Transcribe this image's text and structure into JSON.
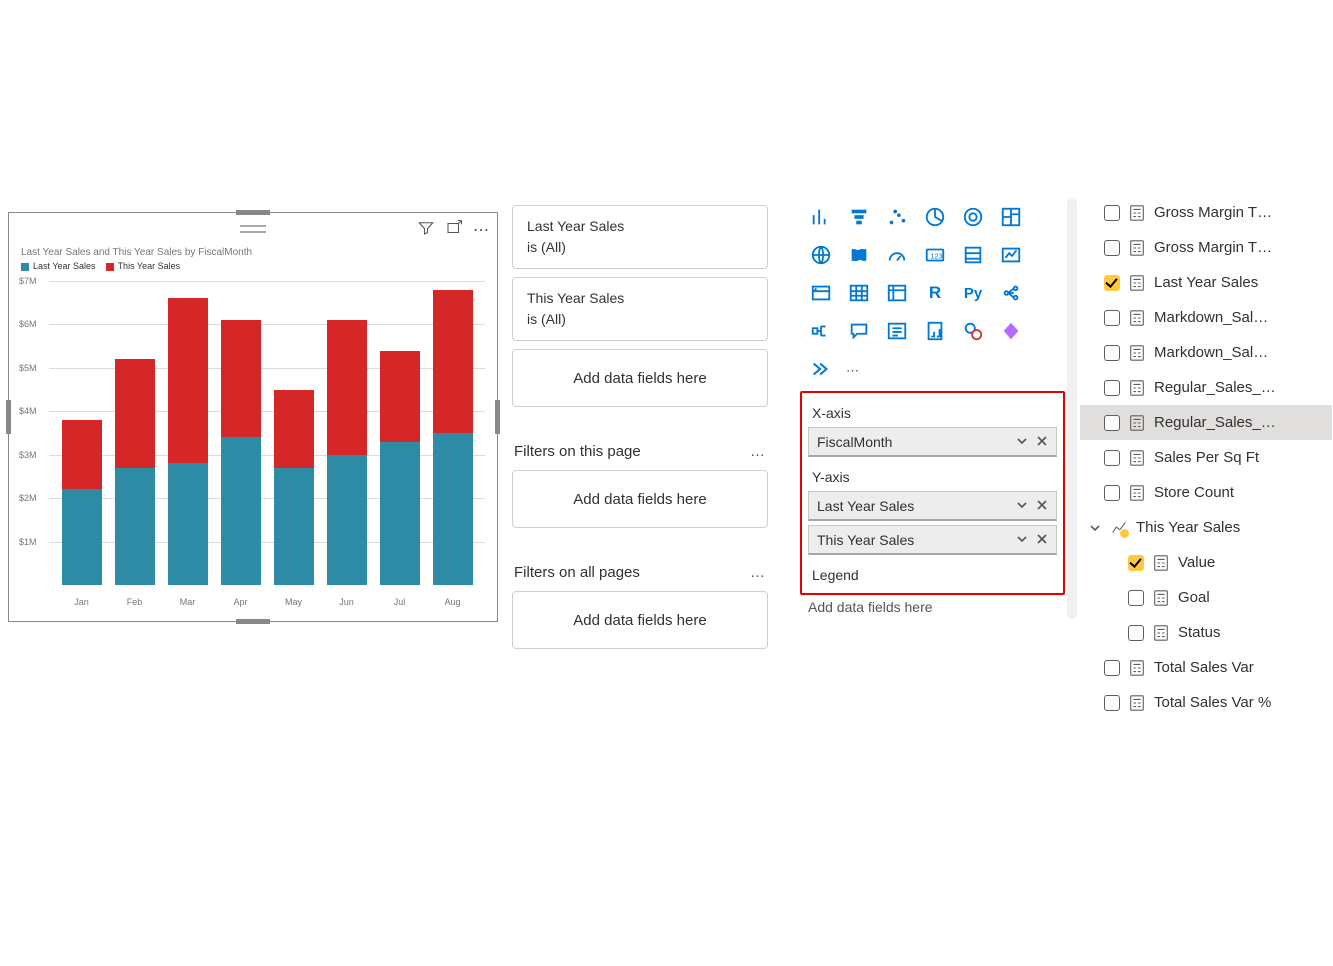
{
  "chart_data": {
    "type": "bar",
    "title": "Last Year Sales and This Year Sales by FiscalMonth",
    "categories": [
      "Jan",
      "Feb",
      "Mar",
      "Apr",
      "May",
      "Jun",
      "Jul",
      "Aug"
    ],
    "series": [
      {
        "name": "Last Year Sales",
        "color": "#2e8ba5",
        "values": [
          2.2,
          2.7,
          2.8,
          3.4,
          2.7,
          3.0,
          3.3,
          3.5
        ]
      },
      {
        "name": "This Year Sales",
        "color": "#d62728",
        "values": [
          1.6,
          2.5,
          3.8,
          2.7,
          1.8,
          3.1,
          2.1,
          3.3
        ]
      }
    ],
    "ylabel": "",
    "ylim": [
      0,
      7
    ],
    "yticks": [
      "$1M",
      "$2M",
      "$3M",
      "$4M",
      "$5M",
      "$6M",
      "$7M"
    ]
  },
  "legend": {
    "a": "Last Year Sales",
    "b": "This Year Sales"
  },
  "filters": {
    "card1": {
      "name": "Last Year Sales",
      "state": "is (All)"
    },
    "card2": {
      "name": "This Year Sales",
      "state": "is (All)"
    },
    "drop": "Add data fields here",
    "page_head": "Filters on this page",
    "all_head": "Filters on all pages"
  },
  "wells": {
    "x_label": "X-axis",
    "x_field": "FiscalMonth",
    "y_label": "Y-axis",
    "y_field1": "Last Year Sales",
    "y_field2": "This Year Sales",
    "legend_label": "Legend",
    "legend_drop": "Add data fields here"
  },
  "fields": {
    "gross_margin_t": "Gross Margin T…",
    "gross_margin_t2": "Gross Margin T…",
    "last_year_sales": "Last Year Sales",
    "markdown_sal1": "Markdown_Sal…",
    "markdown_sal2": "Markdown_Sal…",
    "regular_sales1": "Regular_Sales_…",
    "regular_sales2": "Regular_Sales_…",
    "sales_per_sqft": "Sales Per Sq Ft",
    "store_count": "Store Count",
    "this_year_sales": "This Year Sales",
    "value": "Value",
    "goal": "Goal",
    "status": "Status",
    "total_sales_var": "Total Sales Var",
    "total_sales_var_pct": "Total Sales Var %"
  }
}
